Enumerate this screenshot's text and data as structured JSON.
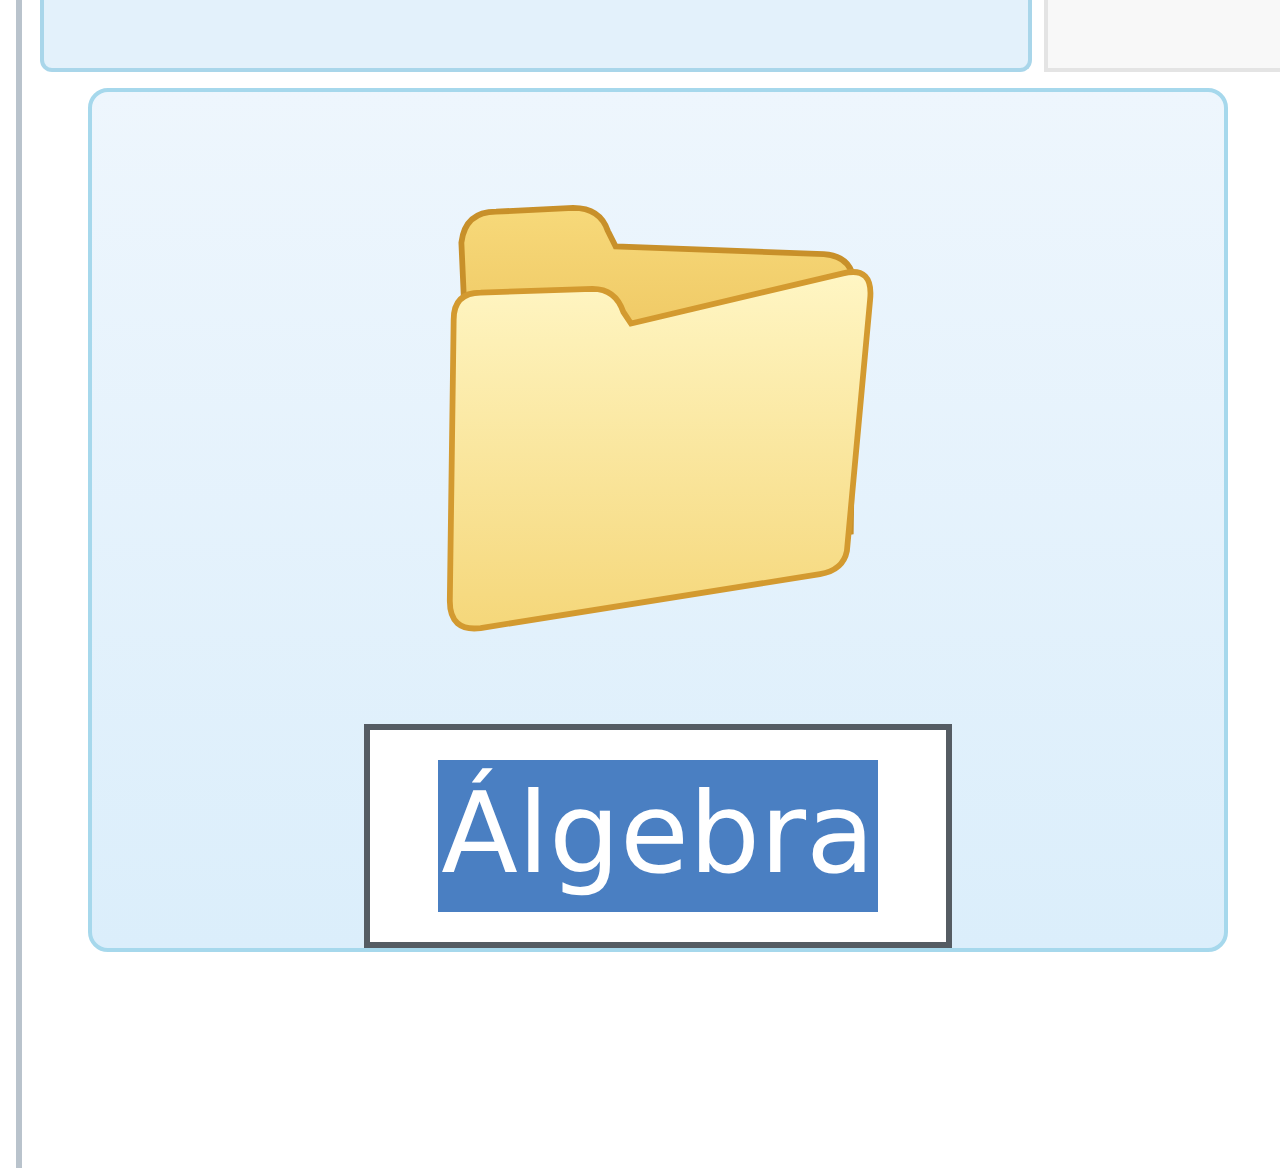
{
  "item": {
    "name": "Álgebra",
    "selected": true,
    "renaming": true
  }
}
